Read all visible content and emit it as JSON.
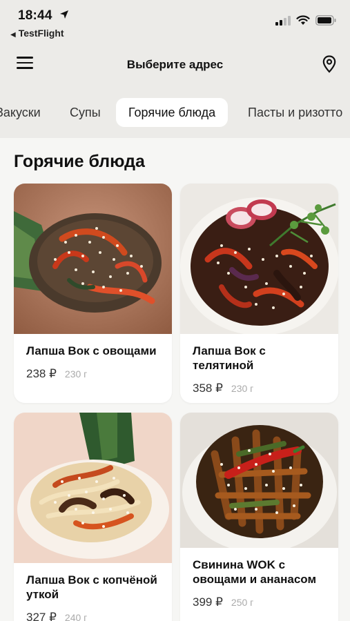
{
  "status": {
    "time": "18:44",
    "back_app": "TestFlight"
  },
  "header": {
    "title": "Выберите адрес"
  },
  "tabs": [
    {
      "label": "Закуски",
      "active": false
    },
    {
      "label": "Супы",
      "active": false
    },
    {
      "label": "Горячие блюда",
      "active": true
    },
    {
      "label": "Пасты и ризотто",
      "active": false
    }
  ],
  "section": {
    "title": "Горячие блюда"
  },
  "products": [
    {
      "name": "Лапша Вок с овощами",
      "price": "238 ₽",
      "weight": "230 г"
    },
    {
      "name": "Лапша Вок с телятиной",
      "price": "358 ₽",
      "weight": "230 г"
    },
    {
      "name": "Лапша Вок с копчёной уткой",
      "price": "327 ₽",
      "weight": "240 г"
    },
    {
      "name": "Свинина WOK с овощами и ананасом",
      "price": "399 ₽",
      "weight": "250 г"
    }
  ],
  "colors": {
    "header_bg": "#ecebe8",
    "content_bg": "#f6f6f4",
    "card_bg": "#ffffff"
  }
}
